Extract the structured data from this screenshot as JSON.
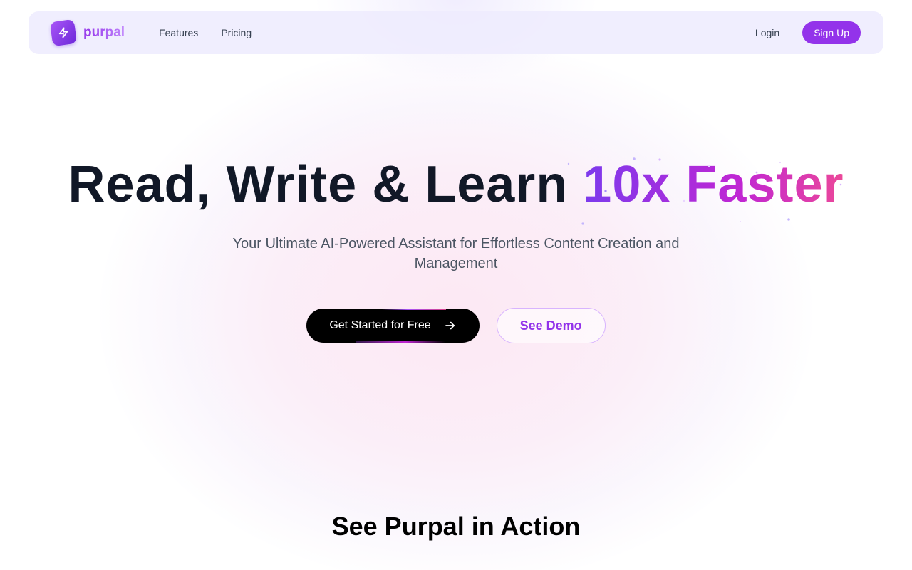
{
  "brand": {
    "name": "purpal",
    "logo_icon": "lightning-bolt-icon",
    "accent_color": "#9333ea"
  },
  "nav": {
    "links": [
      {
        "label": "Features"
      },
      {
        "label": "Pricing"
      }
    ],
    "login_label": "Login",
    "signup_label": "Sign Up"
  },
  "hero": {
    "title_main": "Read, Write & Learn ",
    "title_accent": "10x Faster",
    "subtitle": "Your Ultimate AI-Powered Assistant for Effortless Content Creation and Management",
    "primary_cta": "Get Started for Free",
    "primary_cta_icon": "arrow-right-icon",
    "secondary_cta": "See Demo"
  },
  "demo_section": {
    "title": "See Purpal in Action"
  },
  "colors": {
    "gradient_start": "#7c3aed",
    "gradient_mid": "#c026d3",
    "gradient_end": "#ec4899",
    "text_dark": "#111827",
    "text_muted": "#4b5563"
  }
}
